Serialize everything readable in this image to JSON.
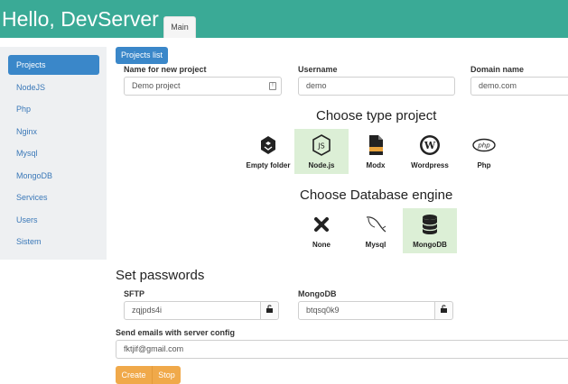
{
  "header": {
    "title": "Hello, DevServer",
    "tab": "Main"
  },
  "sidebar": {
    "items": [
      {
        "label": "Projects",
        "active": true
      },
      {
        "label": "NodeJS"
      },
      {
        "label": "Php"
      },
      {
        "label": "Nginx"
      },
      {
        "label": "Mysql"
      },
      {
        "label": "MongoDB"
      },
      {
        "label": "Services"
      },
      {
        "label": "Users"
      },
      {
        "label": "Sistem"
      }
    ]
  },
  "toolbar": {
    "projects_list": "Projects list"
  },
  "form": {
    "name_label": "Name for new project",
    "name_value": "Demo project",
    "username_label": "Username",
    "username_value": "demo",
    "domain_label": "Domain name",
    "domain_value": "demo.com"
  },
  "project_type": {
    "title": "Choose type project",
    "options": [
      {
        "label": "Empty folder",
        "icon": "empty-folder-icon"
      },
      {
        "label": "Node.js",
        "icon": "nodejs-icon",
        "selected": true
      },
      {
        "label": "Modx",
        "icon": "modx-icon"
      },
      {
        "label": "Wordpress",
        "icon": "wordpress-icon"
      },
      {
        "label": "Php",
        "icon": "php-icon"
      }
    ]
  },
  "database": {
    "title": "Choose Database engine",
    "options": [
      {
        "label": "None",
        "icon": "close-icon"
      },
      {
        "label": "Mysql",
        "icon": "mysql-dolphin-icon"
      },
      {
        "label": "MongoDB",
        "icon": "database-icon",
        "selected": true
      }
    ]
  },
  "passwords": {
    "title": "Set passwords",
    "sftp_label": "SFTP",
    "sftp_value": "zqjpds4i",
    "mongodb_label": "MongoDB",
    "mongodb_value": "btqsq0k9"
  },
  "email": {
    "label": "Send emails with server config",
    "value": "fktjif@gmail.com"
  },
  "actions": {
    "create": "Create",
    "stop": "Stop"
  },
  "colors": {
    "header": "#3aaa96",
    "primary": "#3a87c9",
    "selected": "#dcefd6",
    "warning": "#f0a94a"
  }
}
